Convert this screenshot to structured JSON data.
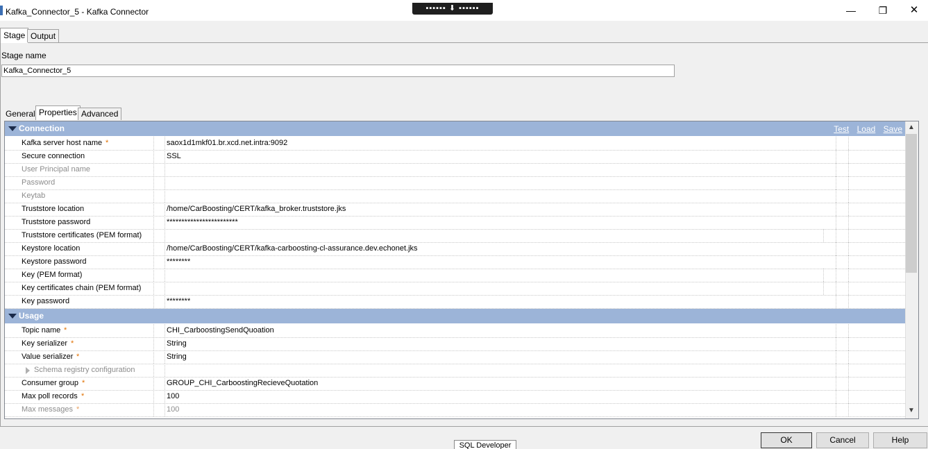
{
  "window": {
    "title": "Kafka_Connector_5 - Kafka Connector",
    "minimize_glyph": "—",
    "maximize_glyph": "❐",
    "close_glyph": "✕",
    "remote_bar": "▪▪▪▪▪▪  ⬇  ▪▪▪▪▪▪"
  },
  "tabs": [
    "Stage",
    "Output"
  ],
  "stage": {
    "name_label": "Stage name",
    "name_value": "Kafka_Connector_5"
  },
  "subtabs": [
    "General",
    "Properties",
    "Advanced"
  ],
  "sections": {
    "connection": {
      "title": "Connection",
      "links": [
        "Test",
        "Load",
        "Save"
      ],
      "rows": [
        {
          "label": "Kafka server host name",
          "required": true,
          "value": "saox1d1mkf01.br.xcd.net.intra:9092",
          "disabled": false
        },
        {
          "label": "Secure connection",
          "required": false,
          "value": "SSL",
          "disabled": false
        },
        {
          "label": "User Principal name",
          "required": false,
          "value": "",
          "disabled": true
        },
        {
          "label": "Password",
          "required": false,
          "value": "",
          "disabled": true
        },
        {
          "label": "Keytab",
          "required": false,
          "value": "",
          "disabled": true
        },
        {
          "label": "Truststore location",
          "required": false,
          "value": "/home/CarBoosting/CERT/kafka_broker.truststore.jks",
          "disabled": false
        },
        {
          "label": "Truststore password",
          "required": false,
          "value": "************************",
          "disabled": false
        },
        {
          "label": "Truststore certificates (PEM format)",
          "required": false,
          "value": "",
          "disabled": false
        },
        {
          "label": "Keystore location",
          "required": false,
          "value": "/home/CarBoosting/CERT/kafka-carboosting-cl-assurance.dev.echonet.jks",
          "disabled": false
        },
        {
          "label": "Keystore password",
          "required": false,
          "value": "********",
          "disabled": false
        },
        {
          "label": "Key (PEM format)",
          "required": false,
          "value": "",
          "disabled": false
        },
        {
          "label": "Key certificates chain (PEM format)",
          "required": false,
          "value": "",
          "disabled": false
        },
        {
          "label": "Key password",
          "required": false,
          "value": "********",
          "disabled": false
        }
      ]
    },
    "usage": {
      "title": "Usage",
      "rows": [
        {
          "label": "Topic name",
          "required": true,
          "value": "CHI_CarboostingSendQuoation",
          "disabled": false
        },
        {
          "label": "Key serializer",
          "required": true,
          "value": "String",
          "disabled": false
        },
        {
          "label": "Value serializer",
          "required": true,
          "value": "String",
          "disabled": false
        },
        {
          "label": "Schema registry configuration",
          "required": false,
          "value": "",
          "disabled": true
        },
        {
          "label": "Consumer group",
          "required": true,
          "value": "GROUP_CHI_CarboostingRecieveQuotation",
          "disabled": false
        },
        {
          "label": "Max poll records",
          "required": true,
          "value": "100",
          "disabled": false
        },
        {
          "label": "Max messages",
          "required": true,
          "value": "100",
          "disabled": true
        }
      ]
    }
  },
  "scroll": {
    "up_glyph": "▲",
    "down_glyph": "▼"
  },
  "buttons": {
    "ok": "OK",
    "cancel": "Cancel",
    "help": "Help"
  },
  "taskbar_tip": "SQL Developer",
  "colors": {
    "section_header": "#9cb4d8",
    "required_marker": "#e07000"
  }
}
